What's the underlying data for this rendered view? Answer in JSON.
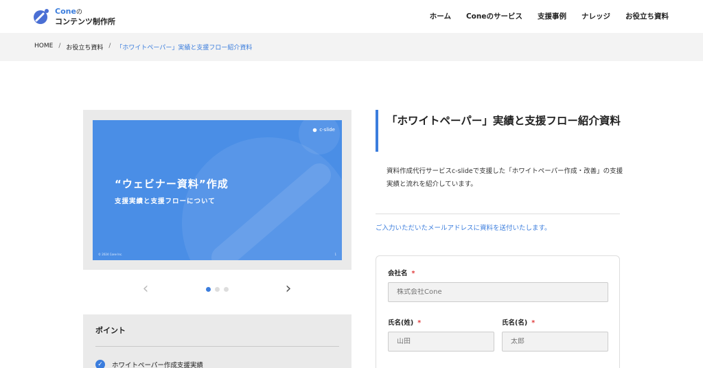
{
  "header": {
    "logo_brand": "Cone",
    "logo_no": "の",
    "logo_sub": "コンテンツ制作所",
    "nav": [
      "ホーム",
      "Coneのサービス",
      "支援事例",
      "ナレッジ",
      "お役立ち資料"
    ]
  },
  "breadcrumb": {
    "home": "HOME",
    "sep": "/",
    "parent": "お役立ち資料",
    "current": "「ホワイトペーパー」実績と支援フロー紹介資料"
  },
  "slide": {
    "brand": "c-slide",
    "title": "“ウェビナー資料”作成",
    "subtitle": "支援実績と支援フローについて",
    "copyright": "© 2024 Cone Inc.",
    "page": "1",
    "background_color": "#4a8ee6"
  },
  "carousel": {
    "prev_icon": "chevron-left-icon",
    "next_icon": "chevron-right-icon",
    "prev": "‹",
    "next": "›",
    "dot_count": 3,
    "active_dot": 0
  },
  "points": {
    "title": "ポイント",
    "items": [
      "ホワイトペーパー作成支援実績"
    ]
  },
  "main": {
    "title": "「ホワイトペーパー」実績と支援フロー紹介資料",
    "description": "資料作成代行サービスc-slideで支援した「ホワイトペーパー作成・改善」の支援実績と流れを紹介しています。",
    "notice": "ご入力いただいたメールアドレスに資料を送付いたします。"
  },
  "form": {
    "company_label": "会社名",
    "company_placeholder": "株式会社Cone",
    "last_name_label": "氏名(姓)",
    "last_name_placeholder": "山田",
    "first_name_label": "氏名(名)",
    "first_name_placeholder": "太郎",
    "required_mark": "*"
  },
  "colors": {
    "accent": "#3b7ddd",
    "required": "#e03b3b"
  }
}
